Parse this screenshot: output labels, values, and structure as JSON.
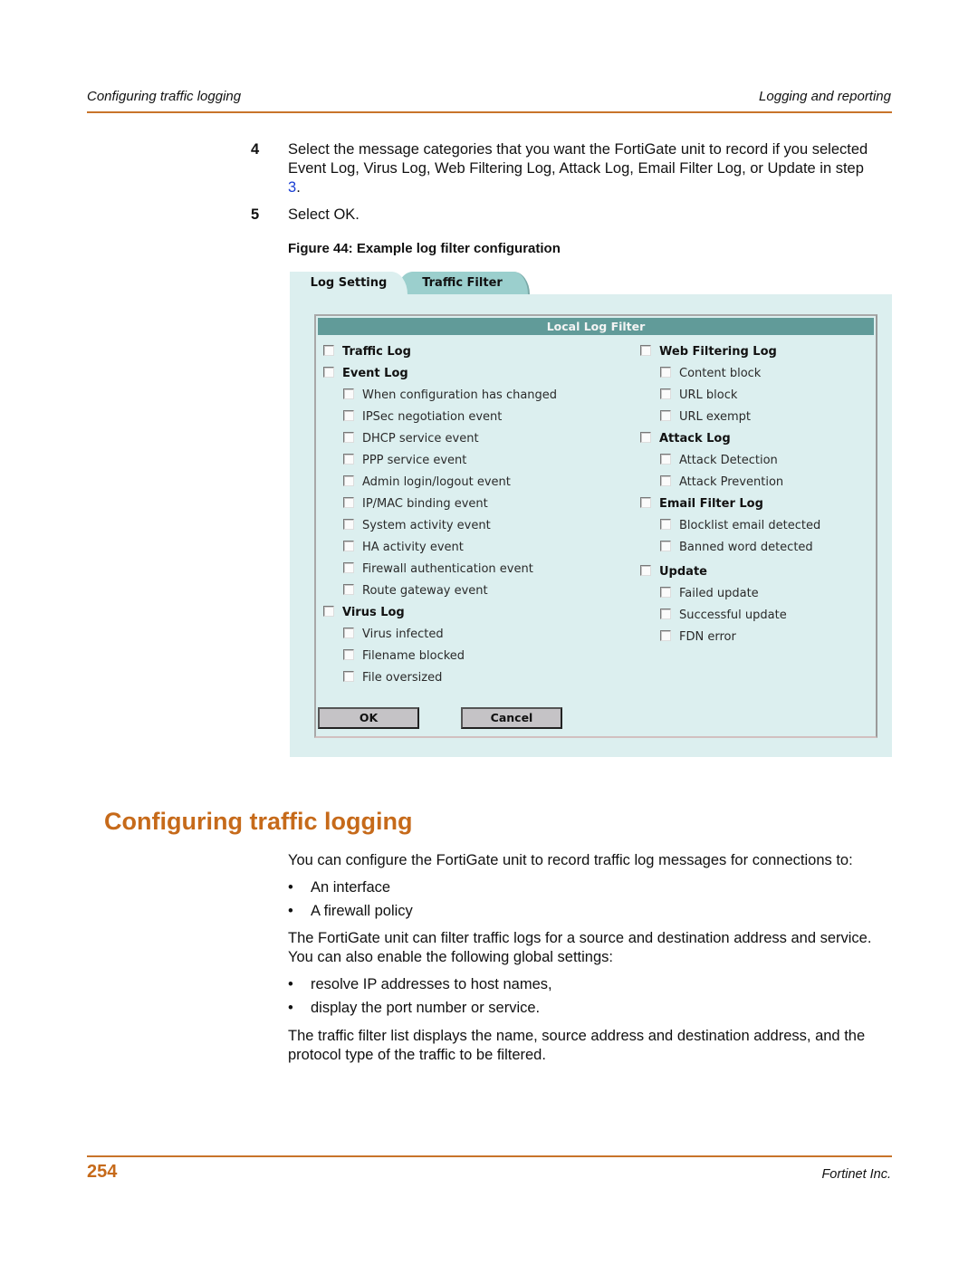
{
  "header": {
    "left": "Configuring traffic logging",
    "right": "Logging and reporting"
  },
  "steps": [
    {
      "num": "4",
      "text_before": "Select the message categories that you want the FortiGate unit to record if you selected Event Log, Virus Log, Web Filtering Log, Attack Log, Email Filter Log, or Update in step ",
      "link": "3",
      "text_after": "."
    },
    {
      "num": "5",
      "text": "Select OK."
    }
  ],
  "figure": {
    "caption": "Figure 44: Example log filter configuration",
    "tabs": [
      "Log Setting",
      "Traffic Filter"
    ],
    "panel_title": "Local Log Filter",
    "left_column": [
      {
        "label": "Traffic Log",
        "type": "category",
        "checked": false
      },
      {
        "label": "Event Log",
        "type": "category",
        "checked": false
      },
      {
        "label": "When configuration has changed",
        "type": "sub",
        "checked": false
      },
      {
        "label": "IPSec negotiation event",
        "type": "sub",
        "checked": false
      },
      {
        "label": "DHCP service event",
        "type": "sub",
        "checked": false
      },
      {
        "label": "PPP service event",
        "type": "sub",
        "checked": false
      },
      {
        "label": "Admin login/logout event",
        "type": "sub",
        "checked": false
      },
      {
        "label": "IP/MAC binding event",
        "type": "sub",
        "checked": false
      },
      {
        "label": "System activity event",
        "type": "sub",
        "checked": false
      },
      {
        "label": "HA activity event",
        "type": "sub",
        "checked": false
      },
      {
        "label": "Firewall authentication event",
        "type": "sub",
        "checked": false
      },
      {
        "label": "Route gateway event",
        "type": "sub",
        "checked": false
      },
      {
        "label": "Virus Log",
        "type": "category",
        "checked": false
      },
      {
        "label": "Virus infected",
        "type": "sub",
        "checked": false
      },
      {
        "label": "Filename blocked",
        "type": "sub",
        "checked": false
      },
      {
        "label": "File oversized",
        "type": "sub",
        "checked": false
      }
    ],
    "right_column": [
      {
        "label": "Web Filtering Log",
        "type": "category",
        "checked": false
      },
      {
        "label": "Content block",
        "type": "sub",
        "checked": false
      },
      {
        "label": "URL block",
        "type": "sub",
        "checked": false
      },
      {
        "label": "URL exempt",
        "type": "sub",
        "checked": false
      },
      {
        "label": "Attack Log",
        "type": "category",
        "checked": false
      },
      {
        "label": "Attack Detection",
        "type": "sub",
        "checked": false
      },
      {
        "label": "Attack Prevention",
        "type": "sub",
        "checked": false
      },
      {
        "label": "Email Filter Log",
        "type": "category",
        "checked": false
      },
      {
        "label": "Blocklist email detected",
        "type": "sub",
        "checked": false
      },
      {
        "label": "Banned word detected",
        "type": "sub",
        "checked": false
      },
      {
        "label": "Update",
        "type": "category",
        "checked": false
      },
      {
        "label": "Failed update",
        "type": "sub",
        "checked": false
      },
      {
        "label": "Successful update",
        "type": "sub",
        "checked": false
      },
      {
        "label": "FDN error",
        "type": "sub",
        "checked": false
      }
    ],
    "buttons": {
      "ok": "OK",
      "cancel": "Cancel"
    }
  },
  "section": {
    "title": "Configuring traffic logging",
    "intro": "You can configure the FortiGate unit to record traffic log messages for connections to:",
    "bullets1": [
      "An interface",
      "A firewall policy"
    ],
    "para2": "The FortiGate unit can filter traffic logs for a source and destination address and service. You can also enable the following global settings:",
    "bullets2": [
      "resolve IP addresses to host names,",
      "display the port number or service."
    ],
    "para3": "The traffic filter list displays the name, source address and destination address, and the protocol type of the traffic to be filtered."
  },
  "footer": {
    "page_number": "254",
    "company": "Fortinet Inc."
  },
  "colors": {
    "accent": "#c66a1a",
    "rule": "#c8742a",
    "panel_bg": "#dcefef",
    "title_bar": "#619b99",
    "active_tab": "#9bcfcd",
    "link": "#1a3fd4"
  }
}
